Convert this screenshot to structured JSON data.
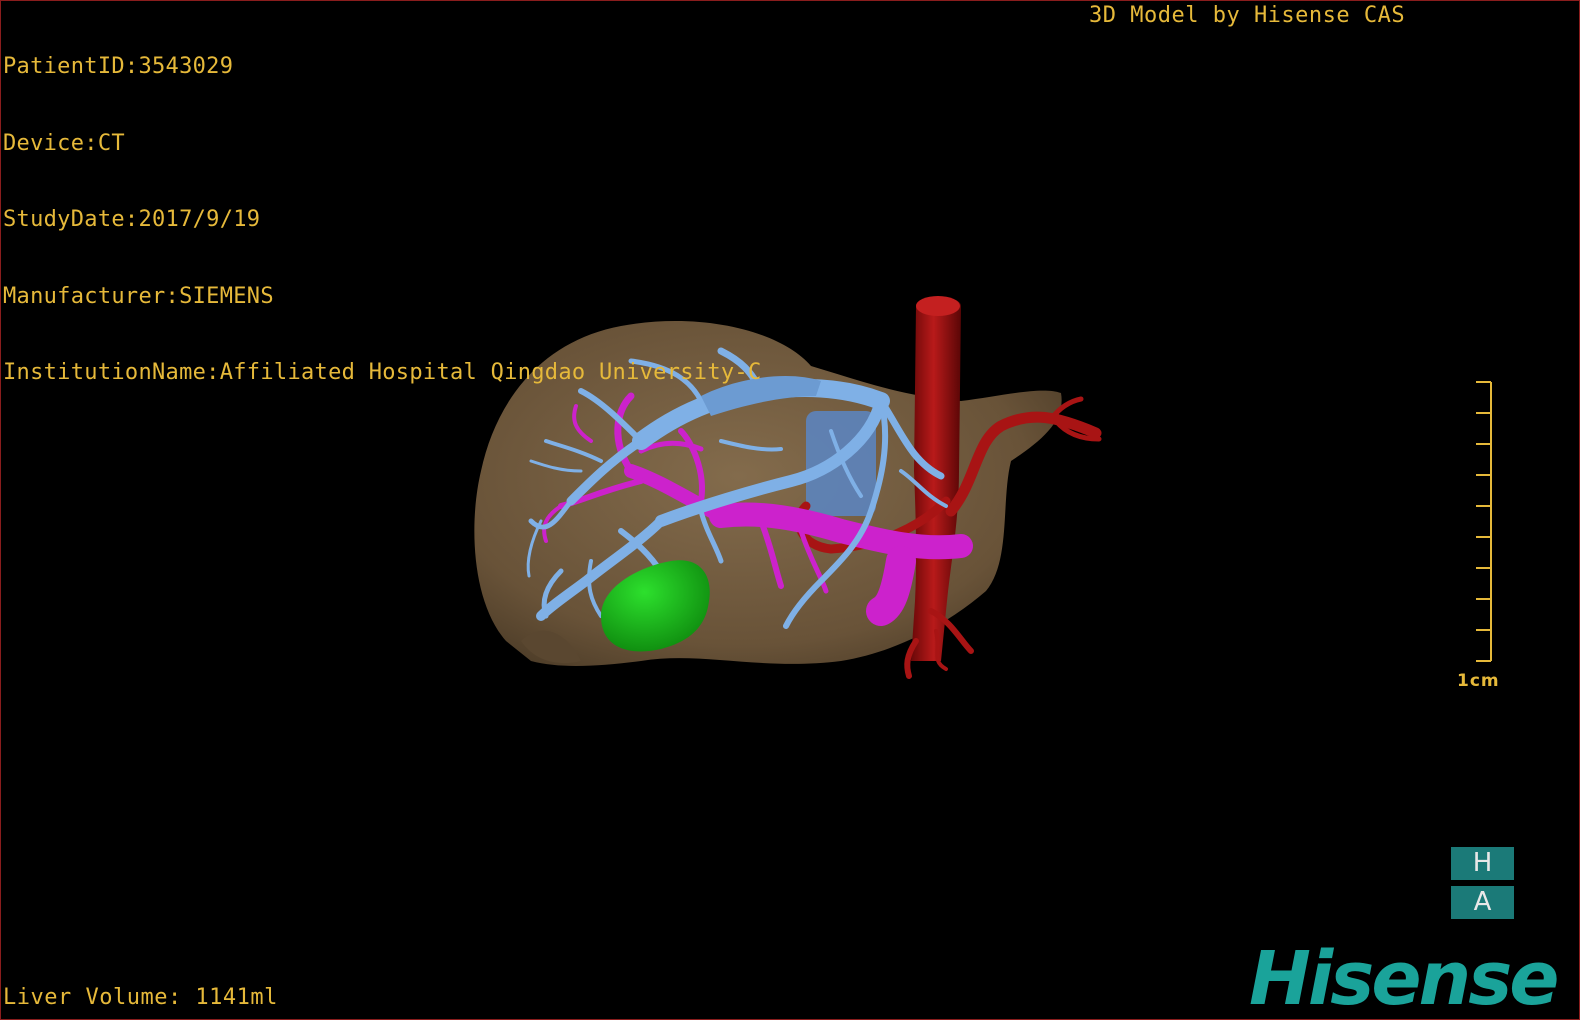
{
  "overlay": {
    "patient_id": "PatientID:3543029",
    "device": "Device:CT",
    "study_date": "StudyDate:2017/9/19",
    "manufacturer": "Manufacturer:SIEMENS",
    "institution": "InstitutionName:Affiliated Hospital Qingdao University-C",
    "credit": "3D Model by Hisense CAS",
    "liver_volume": "Liver Volume: 1141ml"
  },
  "scale": {
    "label": "1cm"
  },
  "orientation": {
    "top": "H",
    "bottom": "A"
  },
  "brand": {
    "logo": "Hisense"
  },
  "colors": {
    "overlay_text": "#e6b93a",
    "liver": "#7a6244",
    "portal_vein": "#7fb0e6",
    "hepatic_vein": "#cc22cc",
    "artery": "#a81414",
    "gallbladder": "#1db81d",
    "brand": "#1aa39a"
  }
}
